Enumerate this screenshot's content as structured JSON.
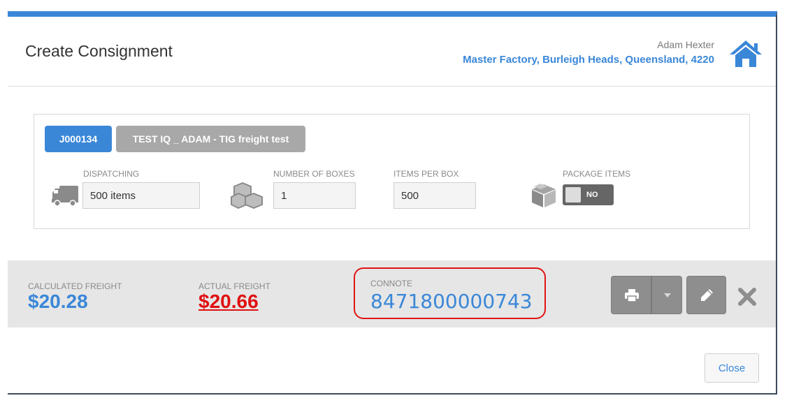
{
  "header": {
    "title": "Create Consignment",
    "user_name": "Adam Hexter",
    "location": "Master Factory, Burleigh Heads, Queensland, 4220"
  },
  "job": {
    "id": "J000134",
    "name": "TEST IQ _ ADAM - TIG freight test"
  },
  "fields": {
    "dispatching": {
      "label": "DISPATCHING",
      "value": "500 items"
    },
    "number_of_boxes": {
      "label": "NUMBER OF BOXES",
      "value": "1"
    },
    "items_per_box": {
      "label": "ITEMS PER BOX",
      "value": "500"
    },
    "package_items": {
      "label": "PACKAGE ITEMS",
      "toggle_label": "NO",
      "enabled": false
    }
  },
  "freight": {
    "calculated": {
      "label": "CALCULATED FREIGHT",
      "value": "$20.28"
    },
    "actual": {
      "label": "ACTUAL FREIGHT",
      "value": "$20.66"
    },
    "connote": {
      "label": "CONNOTE",
      "value": "8471800000743"
    }
  },
  "footer": {
    "close_label": "Close"
  },
  "icons": {
    "home": "home-icon",
    "truck": "truck-icon",
    "boxes": "boxes-icon",
    "package": "package-icon",
    "print": "printer-icon",
    "dropdown": "caret-down-icon",
    "edit": "pencil-icon",
    "close": "close-icon"
  },
  "colors": {
    "accent": "#3a87d8",
    "highlight_red": "#e01010",
    "button_gray": "#8e8e8e"
  }
}
